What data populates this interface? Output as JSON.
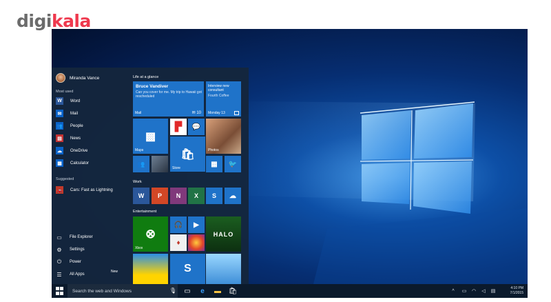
{
  "brand": {
    "part1": "digi",
    "part2": "kala"
  },
  "start_menu": {
    "user_name": "Miranda Vance",
    "most_used_heading": "Most used",
    "most_used": [
      {
        "label": "Word",
        "icon": "word-icon",
        "color": "#2b579a",
        "glyph": "W"
      },
      {
        "label": "Mail",
        "icon": "mail-icon",
        "color": "#0a62c8",
        "glyph": "✉"
      },
      {
        "label": "People",
        "icon": "people-icon",
        "color": "#0a62c8",
        "glyph": "👥"
      },
      {
        "label": "News",
        "icon": "news-icon",
        "color": "#c43333",
        "glyph": "▤"
      },
      {
        "label": "OneDrive",
        "icon": "onedrive-icon",
        "color": "#0a62c8",
        "glyph": "☁"
      },
      {
        "label": "Calculator",
        "icon": "calculator-icon",
        "color": "#0a62c8",
        "glyph": "▦"
      }
    ],
    "suggested_heading": "Suggested",
    "suggested": [
      {
        "label": "Cars: Fast as Lightning",
        "icon": "cars-game-icon",
        "color": "#c0392b"
      }
    ],
    "system_items": [
      {
        "label": "File Explorer",
        "icon": "folder-icon",
        "glyph": "▭"
      },
      {
        "label": "Settings",
        "icon": "gear-icon",
        "glyph": "⚙"
      },
      {
        "label": "Power",
        "icon": "power-icon",
        "glyph": "⏻"
      },
      {
        "label": "All Apps",
        "icon": "all-apps-icon",
        "glyph": "☰"
      }
    ],
    "new_badge": "New",
    "groups": {
      "life": "Life at a glance",
      "work": "Work",
      "entertainment": "Entertainment"
    },
    "tiles": {
      "mail": {
        "sender": "Bruce Vandiver",
        "message": "Can you cover for me. My trip to Hawaii got rescheduled",
        "label": "Mail",
        "count": "10"
      },
      "calendar": {
        "event": "Interview new consultant",
        "place": "Fourth Coffee",
        "label": "Monday 13",
        "color": "#1f73c9"
      },
      "maps": {
        "label": "Maps"
      },
      "photos": {
        "label": "Photos"
      },
      "store": {
        "label": "Store"
      }
    }
  },
  "taskbar": {
    "search_placeholder": "Search the web and Windows",
    "time": "4:10 PM",
    "date": "7/1/2015"
  }
}
